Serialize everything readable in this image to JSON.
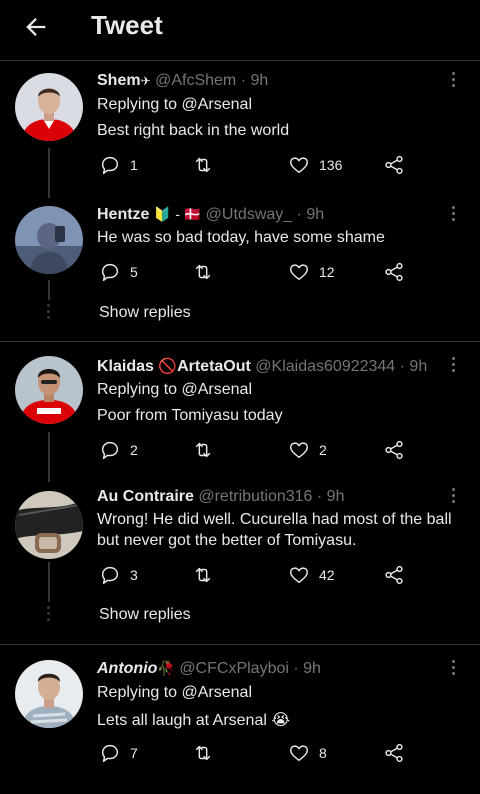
{
  "header": {
    "title": "Tweet"
  },
  "tweets": [
    {
      "name": "Shem",
      "name_emoji": "✈",
      "handle": "@AfcShem",
      "time": "· 9h",
      "replying_prefix": "Replying to ",
      "replying_to": "@Arsenal",
      "text": "Best right back in the world",
      "replies": "1",
      "likes": "136"
    },
    {
      "name": "Hentze",
      "name_emoji": "🔰 - 🇩🇰",
      "handle": "@Utdsway_",
      "time": "· 9h",
      "text": "He was so bad today, have some shame",
      "replies": "5",
      "likes": "12",
      "show_replies": "Show replies"
    },
    {
      "name": "Klaidas",
      "name_emoji": "🚫",
      "name_suffix": "ArtetaOut",
      "handle": "@Klaidas60922344",
      "time": "· 9h",
      "replying_prefix": "Replying to ",
      "replying_to": "@Arsenal",
      "text": "Poor from Tomiyasu today",
      "replies": "2",
      "likes": "2"
    },
    {
      "name": "Au Contraire",
      "handle": "@retribution316",
      "time": "· 9h",
      "text_line1": "Wrong! He did well. Cucurella had most of the ball",
      "text_line2": "but never got the better of Tomiyasu.",
      "replies": "3",
      "likes": "42",
      "show_replies": "Show replies"
    },
    {
      "name": "Antonio",
      "name_emoji": "🥀",
      "handle": "@CFCxPlayboi",
      "time": "· 9h",
      "replying_prefix": "Replying to ",
      "replying_to": "@Arsenal",
      "text": "Lets all laugh at Arsenal",
      "text_emoji": "😭",
      "replies": "7",
      "likes": "8"
    }
  ],
  "colors": {
    "background": "#000000",
    "text": "#e7e9ea",
    "muted": "#71767b",
    "divider": "#2f3336",
    "arsenal_red": "#db0007"
  },
  "icons": [
    "back-arrow-icon",
    "more-icon",
    "reply-icon",
    "retweet-icon",
    "like-icon",
    "share-icon"
  ]
}
